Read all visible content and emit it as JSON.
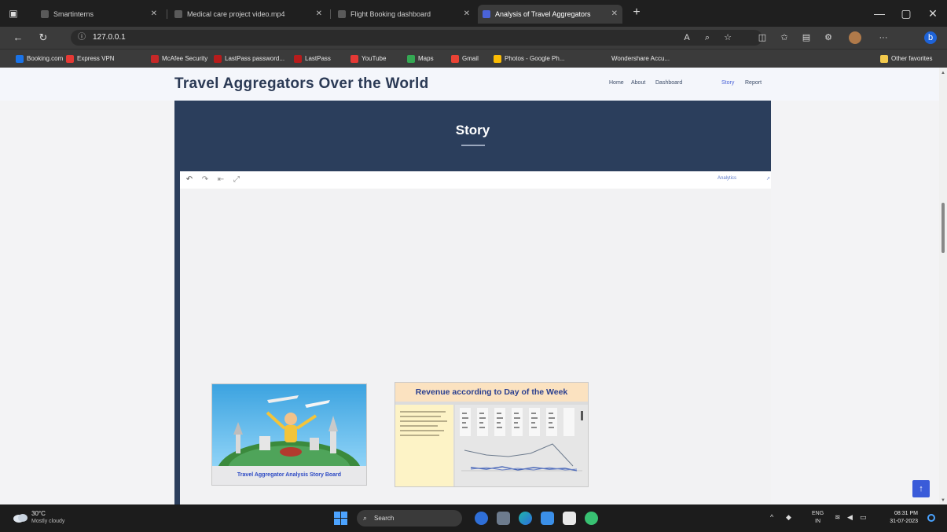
{
  "browser": {
    "tabs": [
      {
        "label": "Smartinterns",
        "active": false
      },
      {
        "label": "Medical care project video.mp4",
        "active": false
      },
      {
        "label": "Flight Booking dashboard",
        "active": false
      },
      {
        "label": "Analysis of Travel Aggregators",
        "active": true
      }
    ],
    "url": "127.0.0.1",
    "bookmarks": [
      {
        "label": "Booking.com",
        "color": "#1a73e8"
      },
      {
        "label": "Express VPN",
        "color": "#e53935"
      },
      {
        "label": "McAfee Security",
        "color": "#c62828"
      },
      {
        "label": "LastPass password...",
        "color": "#b71c1c"
      },
      {
        "label": "LastPass",
        "color": "#b71c1c"
      },
      {
        "label": "YouTube",
        "color": "#e53935"
      },
      {
        "label": "Maps",
        "color": "#34a853"
      },
      {
        "label": "Gmail",
        "color": "#ea4335"
      },
      {
        "label": "Photos - Google Ph...",
        "color": "#fbbc04"
      },
      {
        "label": "Wondershare Accu...",
        "color": "#555555"
      }
    ],
    "other_favorites": "Other favorites"
  },
  "site": {
    "title": "Travel Aggregators Over the World",
    "nav": [
      {
        "label": "Home",
        "active": false
      },
      {
        "label": "About",
        "active": false
      },
      {
        "label": "Dashboard",
        "active": false
      },
      {
        "label": "Story",
        "active": true
      },
      {
        "label": "Report",
        "active": false
      }
    ],
    "hero_title": "Story"
  },
  "story": {
    "toolbar_right": "Analytics",
    "points": [
      {
        "caption": "Travel Aggregator Analysis Story Board"
      },
      {
        "caption": "Revenue according to Day of the Week"
      }
    ]
  },
  "taskbar": {
    "weather_temp": "30°C",
    "weather_desc": "Mostly cloudy",
    "search_placeholder": "Search",
    "lang_top": "ENG",
    "lang_bottom": "IN",
    "time": "08:31 PM",
    "date": "31-07-2023"
  },
  "colors": {
    "accent": "#3a5bd9",
    "hero": "#2b3e5c",
    "title_text": "#2b3a55"
  }
}
